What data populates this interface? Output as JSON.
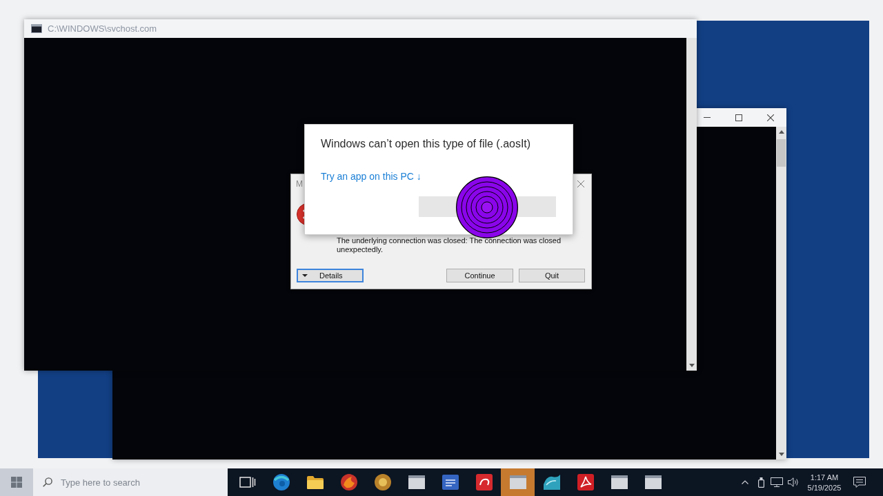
{
  "console_window": {
    "title": "C:\\WINDOWS\\svchost.com"
  },
  "error_dialog": {
    "title": "M",
    "message": "The underlying connection was closed: The connection was closed unexpectedly.",
    "buttons": [
      {
        "label": "Details",
        "kind": "expander",
        "focused": true
      },
      {
        "label": "Continue",
        "kind": "push",
        "focused": false
      },
      {
        "label": "Quit",
        "kind": "push",
        "focused": false
      }
    ]
  },
  "open_with_dialog": {
    "title": "Windows can’t open this type of file (.aosIt)",
    "link": "Try an app on this PC ↓"
  },
  "taskbar": {
    "search": {
      "placeholder": "Type here to search"
    },
    "apps": [
      {
        "kind": "task-view",
        "selected": false
      },
      {
        "kind": "globe",
        "selected": false
      },
      {
        "kind": "folder",
        "selected": false
      },
      {
        "kind": "flame",
        "selected": false
      },
      {
        "kind": "disc",
        "selected": false
      },
      {
        "kind": "window",
        "selected": false
      },
      {
        "kind": "tile",
        "selected": false
      },
      {
        "kind": "swirl",
        "selected": false
      },
      {
        "kind": "window",
        "selected": true
      },
      {
        "kind": "wave",
        "selected": false
      },
      {
        "kind": "pdf",
        "selected": false
      },
      {
        "kind": "window",
        "selected": false
      },
      {
        "kind": "window",
        "selected": false
      }
    ],
    "clock": {
      "time": "1:17 AM",
      "date": "5/19/2025"
    }
  }
}
